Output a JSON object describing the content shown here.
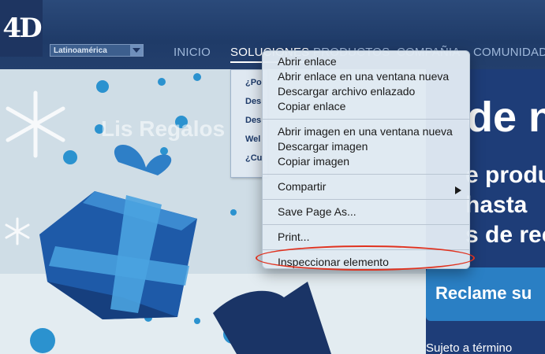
{
  "brand": {
    "logo_text": "4D"
  },
  "region_select": {
    "value": "Latinoamérica"
  },
  "nav": {
    "inicio": "INICIO",
    "soluciones": "SOLUCIONES",
    "productos": "PRODUCTOS",
    "compania": "COMPAÑIA",
    "comunidad": "COMUNIDAD"
  },
  "submenu": {
    "items": [
      "¿Po",
      "Des",
      "Des",
      "Wel",
      "¿Cu"
    ]
  },
  "hero": {
    "ghost_text": "Lis Regalos",
    "line1": "de n",
    "line2": "e produ",
    "line3": "hasta ",
    "line4": "s de rec",
    "cta": "Reclame su",
    "terms": "Sujeto a término"
  },
  "context_menu": {
    "group1": [
      "Abrir enlace",
      "Abrir enlace en una ventana nueva",
      "Descargar archivo enlazado",
      "Copiar enlace"
    ],
    "group2": [
      "Abrir imagen en una ventana nueva",
      "Descargar imagen",
      "Copiar imagen"
    ],
    "share": "Compartir",
    "save_page": "Save Page As...",
    "print": "Print...",
    "inspect": "Inspeccionar elemento"
  },
  "colors": {
    "nav_bg": "#1f3b68",
    "hero_dark": "#1e3d78",
    "cta_blue": "#2a7fc4",
    "highlight_red": "#e0321f"
  }
}
